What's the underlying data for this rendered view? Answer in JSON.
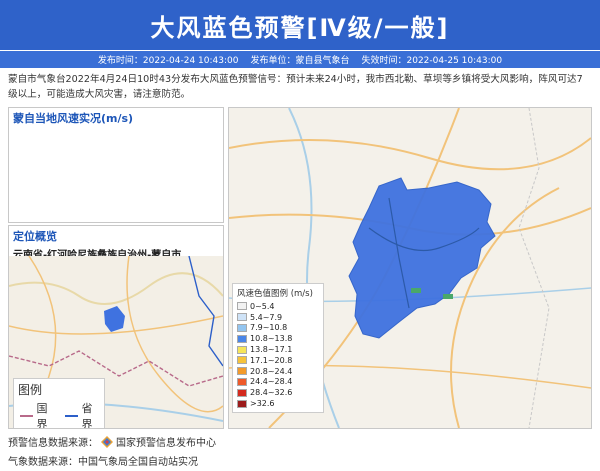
{
  "header": {
    "title": "大风蓝色预警[Ⅳ级/一般]",
    "publish_time": "发布时间：2022-04-24 10:43:00",
    "publisher": "发布单位：蒙自县气象台",
    "expire_time": "失效时间：2022-04-25 10:43:00"
  },
  "body": {
    "text": "蒙自市气象台2022年4月24日10时43分发布大风蓝色预警信号：预计未来24小时，我市西北勒、草坝等乡镇将受大风影响，阵风可达7级以上，可能造成大风灾害，请注意防范。"
  },
  "wind_panel": {
    "title": "蒙自当地风速实况(m/s)"
  },
  "location_panel": {
    "title": "定位概览",
    "subtitle": "云南省-红河哈尼族彝族自治州-蒙自市"
  },
  "map_legend": {
    "title": "图例",
    "items": [
      {
        "label": "国界",
        "color": "#b86a8a"
      },
      {
        "label": "省界",
        "color": "#2c5fc9"
      }
    ]
  },
  "wind_legend": {
    "title": "风速色值图例 (m/s)",
    "items": [
      {
        "label": "0~5.4",
        "color": "#f2f2f2"
      },
      {
        "label": "5.4~7.9",
        "color": "#cfe3f7"
      },
      {
        "label": "7.9~10.8",
        "color": "#93c5f0"
      },
      {
        "label": "10.8~13.8",
        "color": "#4a86e8"
      },
      {
        "label": "13.8~17.1",
        "color": "#f6e55a"
      },
      {
        "label": "17.1~20.8",
        "color": "#f6c33a"
      },
      {
        "label": "20.8~24.4",
        "color": "#f39a2a"
      },
      {
        "label": "24.4~28.4",
        "color": "#ee5a2a"
      },
      {
        "label": "28.4~32.6",
        "color": "#d42a1e"
      },
      {
        "label": ">32.6",
        "color": "#9b1b1b"
      }
    ]
  },
  "footer": {
    "warning_source_label": "预警信息数据来源：",
    "warning_source": "国家预警信息发布中心",
    "weather_source": "气象数据来源：中国气象局全国自动站实况"
  },
  "colors": {
    "banner": "#2f62c9",
    "warning_area": "#3f72e0"
  }
}
